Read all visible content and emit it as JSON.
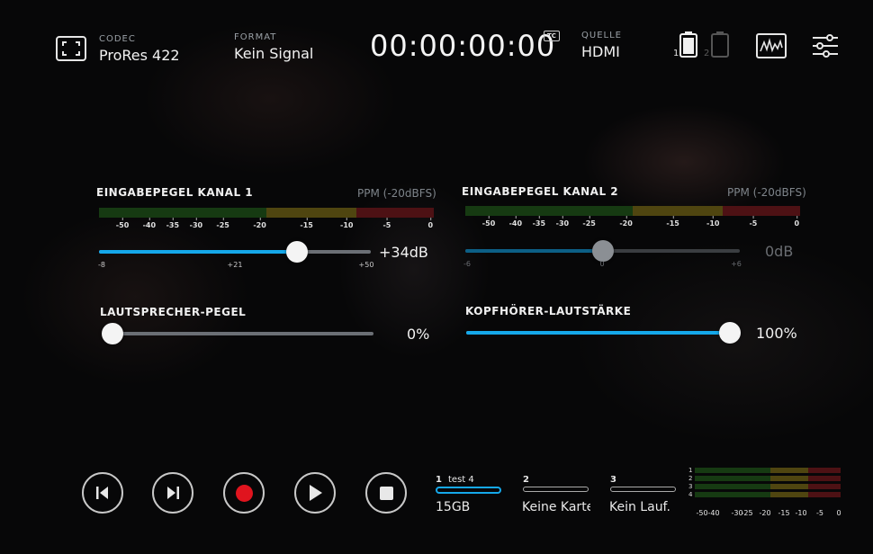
{
  "header": {
    "codec_label": "CODEC",
    "codec_value": "ProRes 422",
    "format_label": "FORMAT",
    "format_value": "Kein Signal",
    "timecode": "00:00:00:00",
    "tc_badge": "TC",
    "source_label": "QUELLE",
    "source_value": "HDMI",
    "battery1_label": "1",
    "battery2_label": "2",
    "icons": [
      "fullscreen-icon",
      "battery-icon",
      "waveform-icon",
      "settings-sliders-icon"
    ]
  },
  "channel1": {
    "title": "EINGABEPEGEL KANAL 1",
    "scale": "PPM (-20dBFS)",
    "ticks": [
      "-50",
      "-40",
      "-35",
      "-30",
      "-25",
      "-20",
      "-15",
      "-10",
      "-5",
      "0"
    ],
    "slider_min": "-8",
    "slider_mid": "+21",
    "slider_max": "+50",
    "value": "+34dB",
    "level": 0.73
  },
  "channel2": {
    "title": "EINGABEPEGEL KANAL 2",
    "scale": "PPM (-20dBFS)",
    "ticks": [
      "-50",
      "-40",
      "-35",
      "-30",
      "-25",
      "-20",
      "-15",
      "-10",
      "-5",
      "0"
    ],
    "slider_min": "-6",
    "slider_mid": "0",
    "slider_max": "+6",
    "value": "0dB",
    "level": 0.5
  },
  "speaker": {
    "title": "LAUTSPRECHER-PEGEL",
    "value": "0%",
    "level": 0.0
  },
  "headphone": {
    "title": "KOPFHÖRER-LAUTSTÄRKE",
    "value": "100%",
    "level": 1.0
  },
  "transport": {
    "buttons": [
      "skip-back",
      "skip-forward",
      "record",
      "play",
      "stop"
    ]
  },
  "media": [
    {
      "slot": "1",
      "name": "test 4",
      "status": "15GB",
      "active": true
    },
    {
      "slot": "2",
      "name": "",
      "status": "Keine Karte",
      "active": false
    },
    {
      "slot": "3",
      "name": "",
      "status": "Kein Lauf.",
      "active": false
    }
  ],
  "mini_meter": {
    "channels": [
      "1",
      "2",
      "3",
      "4"
    ],
    "scale": [
      "-50",
      "-40",
      "-30",
      "-25",
      "-20",
      "-15",
      "-10",
      "-5",
      "0"
    ]
  },
  "colors": {
    "accent": "#15a8ea",
    "meter_green": "#163a12",
    "meter_yellow": "#4f4510",
    "meter_red": "#4d1114",
    "record": "#e0141e"
  }
}
